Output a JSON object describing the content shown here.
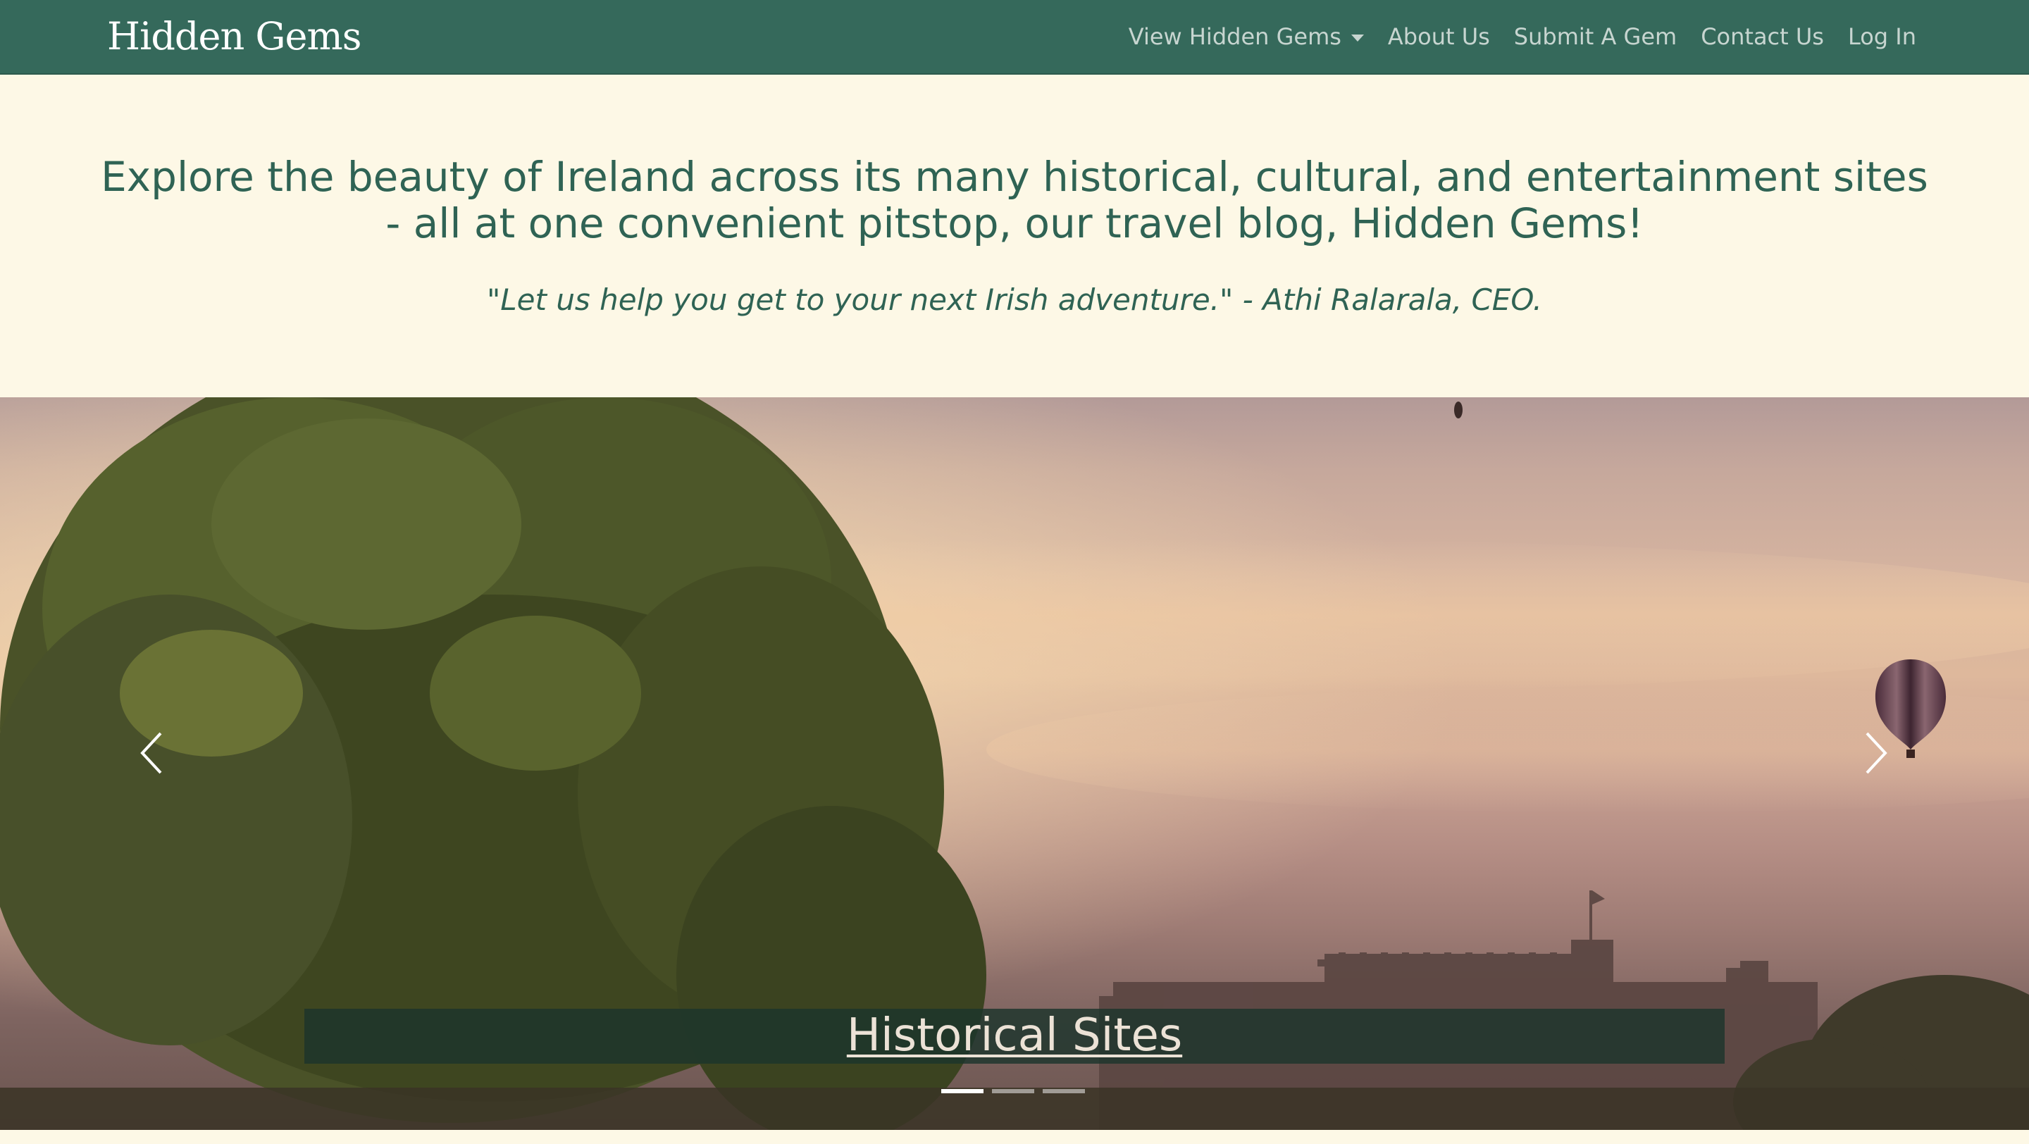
{
  "navbar": {
    "brand": "Hidden Gems",
    "links": [
      {
        "label": "View Hidden Gems",
        "dropdown": true
      },
      {
        "label": "About Us"
      },
      {
        "label": "Submit A Gem"
      },
      {
        "label": "Contact Us"
      },
      {
        "label": "Log In"
      }
    ]
  },
  "hero": {
    "title": "Explore the beauty of Ireland across its many historical, cultural, and entertainment sites - all at one convenient pitstop, our travel blog, Hidden Gems!",
    "quote": "\"Let us help you get to your next Irish adventure.\" - Athi Ralarala, CEO."
  },
  "carousel": {
    "caption": "Historical Sites",
    "slide_count": 3,
    "active_slide": 1,
    "prev_icon": "chevron-left-icon",
    "next_icon": "chevron-right-icon"
  },
  "colors": {
    "navbar_bg": "#35695b",
    "page_bg": "#fdf8e6",
    "text_green": "#2f6354",
    "nav_link": "#c7d5d0"
  }
}
